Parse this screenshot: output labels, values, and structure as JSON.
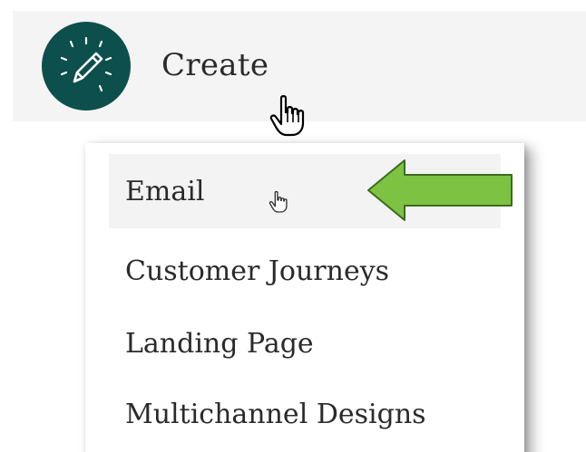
{
  "create_button": {
    "label": "Create",
    "icon": "pencil-icon",
    "icon_bg_color": "#0d4f4d"
  },
  "create_menu": {
    "items": [
      {
        "label": "Email",
        "hovered": true
      },
      {
        "label": "Customer Journeys",
        "hovered": false
      },
      {
        "label": "Landing Page",
        "hovered": false
      },
      {
        "label": "Multichannel Designs",
        "hovered": false
      }
    ]
  },
  "annotation": {
    "arrow": "green-arrow-pointing-left",
    "arrow_color": "#7dc242"
  }
}
